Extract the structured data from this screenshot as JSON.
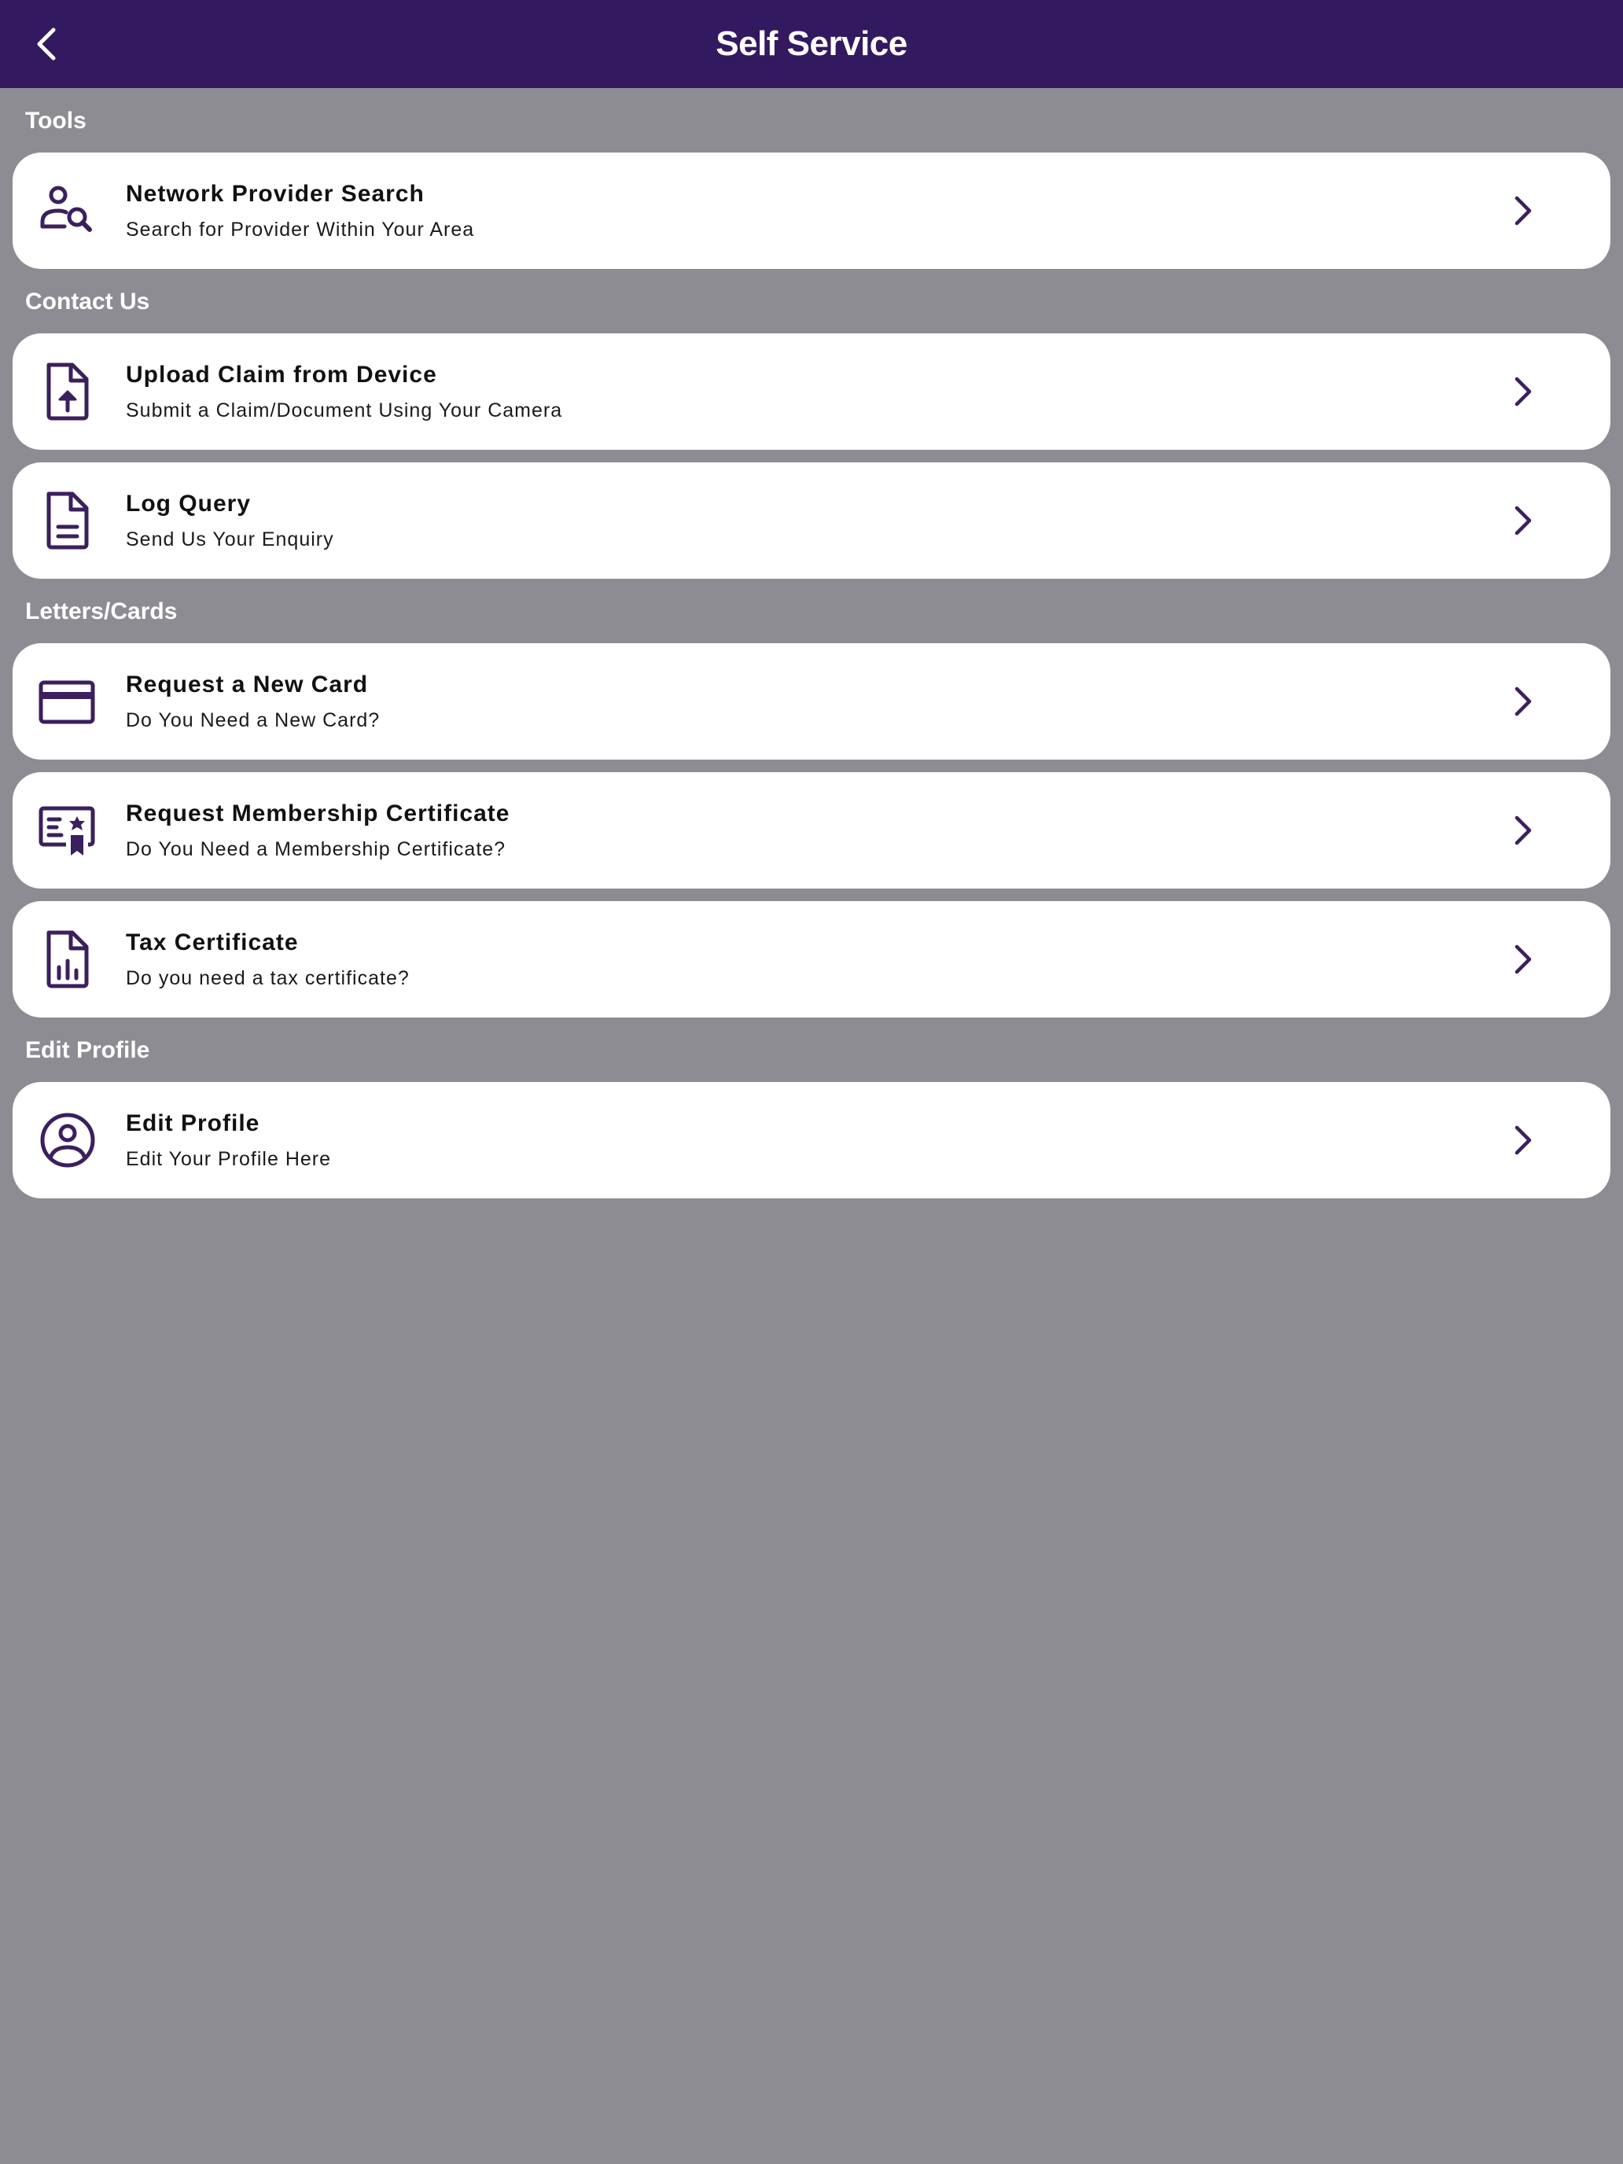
{
  "header": {
    "title": "Self Service",
    "back_icon": "chevron-left-icon"
  },
  "colors": {
    "header_bg": "#331960",
    "page_bg": "#8e8c93",
    "icon": "#3b1f5e",
    "card_bg": "#ffffff"
  },
  "sections": [
    {
      "label": "Tools",
      "items": [
        {
          "title": "Network Provider Search",
          "subtitle": "Search for Provider Within Your Area",
          "icon": "user-search-icon"
        }
      ]
    },
    {
      "label": "Contact Us",
      "items": [
        {
          "title": "Upload Claim from Device",
          "subtitle": "Submit a Claim/Document Using Your Camera",
          "icon": "file-upload-icon"
        },
        {
          "title": "Log Query",
          "subtitle": "Send Us Your Enquiry",
          "icon": "document-icon"
        }
      ]
    },
    {
      "label": "Letters/Cards",
      "items": [
        {
          "title": "Request a New Card",
          "subtitle": "Do You Need a New Card?",
          "icon": "credit-card-icon"
        },
        {
          "title": "Request Membership Certificate",
          "subtitle": "Do You Need a Membership Certificate?",
          "icon": "certificate-icon"
        },
        {
          "title": "Tax Certificate",
          "subtitle": "Do you need a tax certificate?",
          "icon": "file-chart-icon"
        }
      ]
    },
    {
      "label": "Edit Profile",
      "items": [
        {
          "title": "Edit Profile",
          "subtitle": "Edit Your Profile Here",
          "icon": "user-circle-icon"
        }
      ]
    }
  ]
}
